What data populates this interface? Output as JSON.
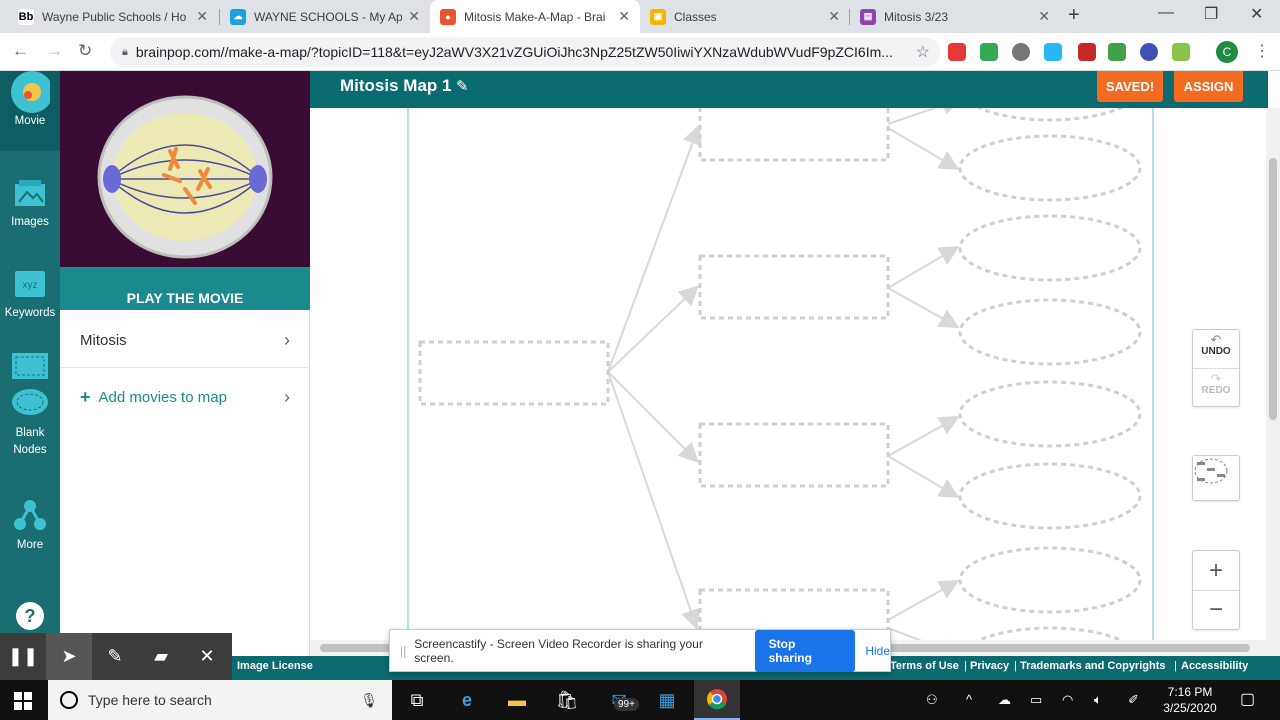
{
  "browser": {
    "tabs": [
      {
        "title": "Wayne Public Schools / Ho",
        "icon": "blackboard-icon",
        "color": "#2b2b2b",
        "glyph": "Bb"
      },
      {
        "title": "WAYNE SCHOOLS - My App",
        "icon": "cloud-icon",
        "color": "#1ba1e2",
        "glyph": ""
      },
      {
        "title": "Mitosis Make-A-Map - Brai",
        "icon": "brainpop-icon",
        "color": "#e8542d",
        "glyph": ""
      },
      {
        "title": "Classes",
        "icon": "classroom-icon",
        "color": "#f4b400",
        "glyph": ""
      },
      {
        "title": "Mitosis 3/23",
        "icon": "assignment-icon",
        "color": "#8e44ad",
        "glyph": ""
      }
    ],
    "url": "brainpop.com//make-a-map/?topicID=118&t=eyJ2aWV3X21vZGUiOiJhc3NpZ25tZW50IiwiYXNzaWdubWVudF9pZCI6Im...",
    "profile_initial": "C"
  },
  "rail": {
    "items": [
      {
        "label": "Movie",
        "icon": "movie-icon"
      },
      {
        "label": "Images",
        "icon": "images-icon"
      },
      {
        "label": "Keywords",
        "icon": "keywords-icon",
        "badge": "xyz"
      },
      {
        "label": "Blank Nodes",
        "icon": "blank-nodes-icon"
      },
      {
        "label": "More",
        "icon": "more-icon"
      }
    ],
    "help_icon": "help-icon"
  },
  "panel": {
    "play_label": "PLAY THE MOVIE",
    "movie_item": "Mitosis",
    "add_label": "Add movies to map"
  },
  "header": {
    "title": "Mitosis Map 1",
    "saved_label": "SAVED!",
    "assign_label": "ASSIGN"
  },
  "controls": {
    "undo_label": "UNDO",
    "redo_label": "REDO"
  },
  "footer": {
    "image_license": "Image License",
    "terms": "Terms of Use",
    "privacy": "Privacy",
    "trademarks": "Trademarks and Copyrights",
    "accessibility": "Accessibility"
  },
  "share": {
    "message": "Screencastify - Screen Video Recorder is sharing your screen.",
    "stop_label": "Stop sharing",
    "hide_label": "Hide"
  },
  "taskbar": {
    "search_placeholder": "Type here to search",
    "mail_badge": "99+",
    "time": "7:16 PM",
    "date": "3/25/2020"
  },
  "colors": {
    "teal": "#0b6b70",
    "orange": "#f26b21",
    "accent": "#1a8a8f"
  }
}
